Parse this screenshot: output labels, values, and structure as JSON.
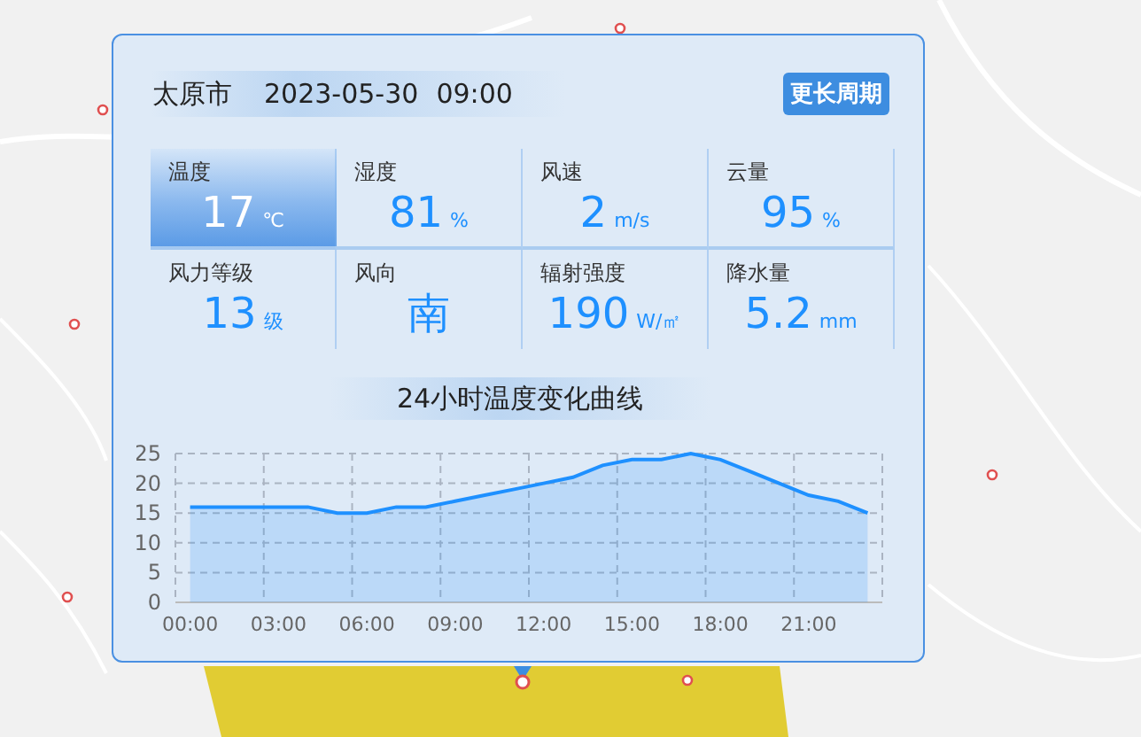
{
  "header": {
    "city": "太原市",
    "date": "2023-05-30",
    "time": "09:00",
    "button": "更长周期"
  },
  "metrics": [
    {
      "label": "温度",
      "value": "17",
      "unit": "℃",
      "selected": true
    },
    {
      "label": "湿度",
      "value": "81",
      "unit": "%",
      "selected": false
    },
    {
      "label": "风速",
      "value": "2",
      "unit": "m/s",
      "selected": false
    },
    {
      "label": "云量",
      "value": "95",
      "unit": "%",
      "selected": false
    },
    {
      "label": "风力等级",
      "value": "13",
      "unit": "级",
      "selected": false
    },
    {
      "label": "风向",
      "value": "南",
      "selected": false
    },
    {
      "label": "辐射强度",
      "value": "190",
      "unit": "W/㎡",
      "selected": false
    },
    {
      "label": "降水量",
      "value": "5.2",
      "unit": "mm",
      "selected": false
    }
  ],
  "chart": {
    "title": "24小时温度变化曲线",
    "chart_data": {
      "type": "area",
      "x": [
        0,
        1,
        2,
        3,
        4,
        5,
        6,
        7,
        8,
        9,
        10,
        11,
        12,
        13,
        14,
        15,
        16,
        17,
        18,
        19,
        20,
        21,
        22,
        23
      ],
      "series": [
        {
          "color": "#1e90ff",
          "values": [
            16,
            16,
            16,
            16,
            16,
            15,
            15,
            16,
            16,
            17,
            18,
            19,
            20,
            21,
            23,
            24,
            24,
            25,
            24,
            22,
            20,
            18,
            17,
            15
          ]
        }
      ],
      "xlim": [
        -0.5,
        23.5
      ],
      "grid": true,
      "ylim": [
        0,
        25
      ],
      "yticks": [
        0,
        5,
        10,
        15,
        20,
        25
      ],
      "xticks": [
        {
          "value": 0,
          "label": "00:00"
        },
        {
          "value": 3,
          "label": "03:00"
        },
        {
          "value": 6,
          "label": "06:00"
        },
        {
          "value": 9,
          "label": "09:00"
        },
        {
          "value": 12,
          "label": "12:00"
        },
        {
          "value": 15,
          "label": "15:00"
        },
        {
          "value": 18,
          "label": "18:00"
        },
        {
          "value": 21,
          "label": "21:00"
        }
      ]
    }
  }
}
